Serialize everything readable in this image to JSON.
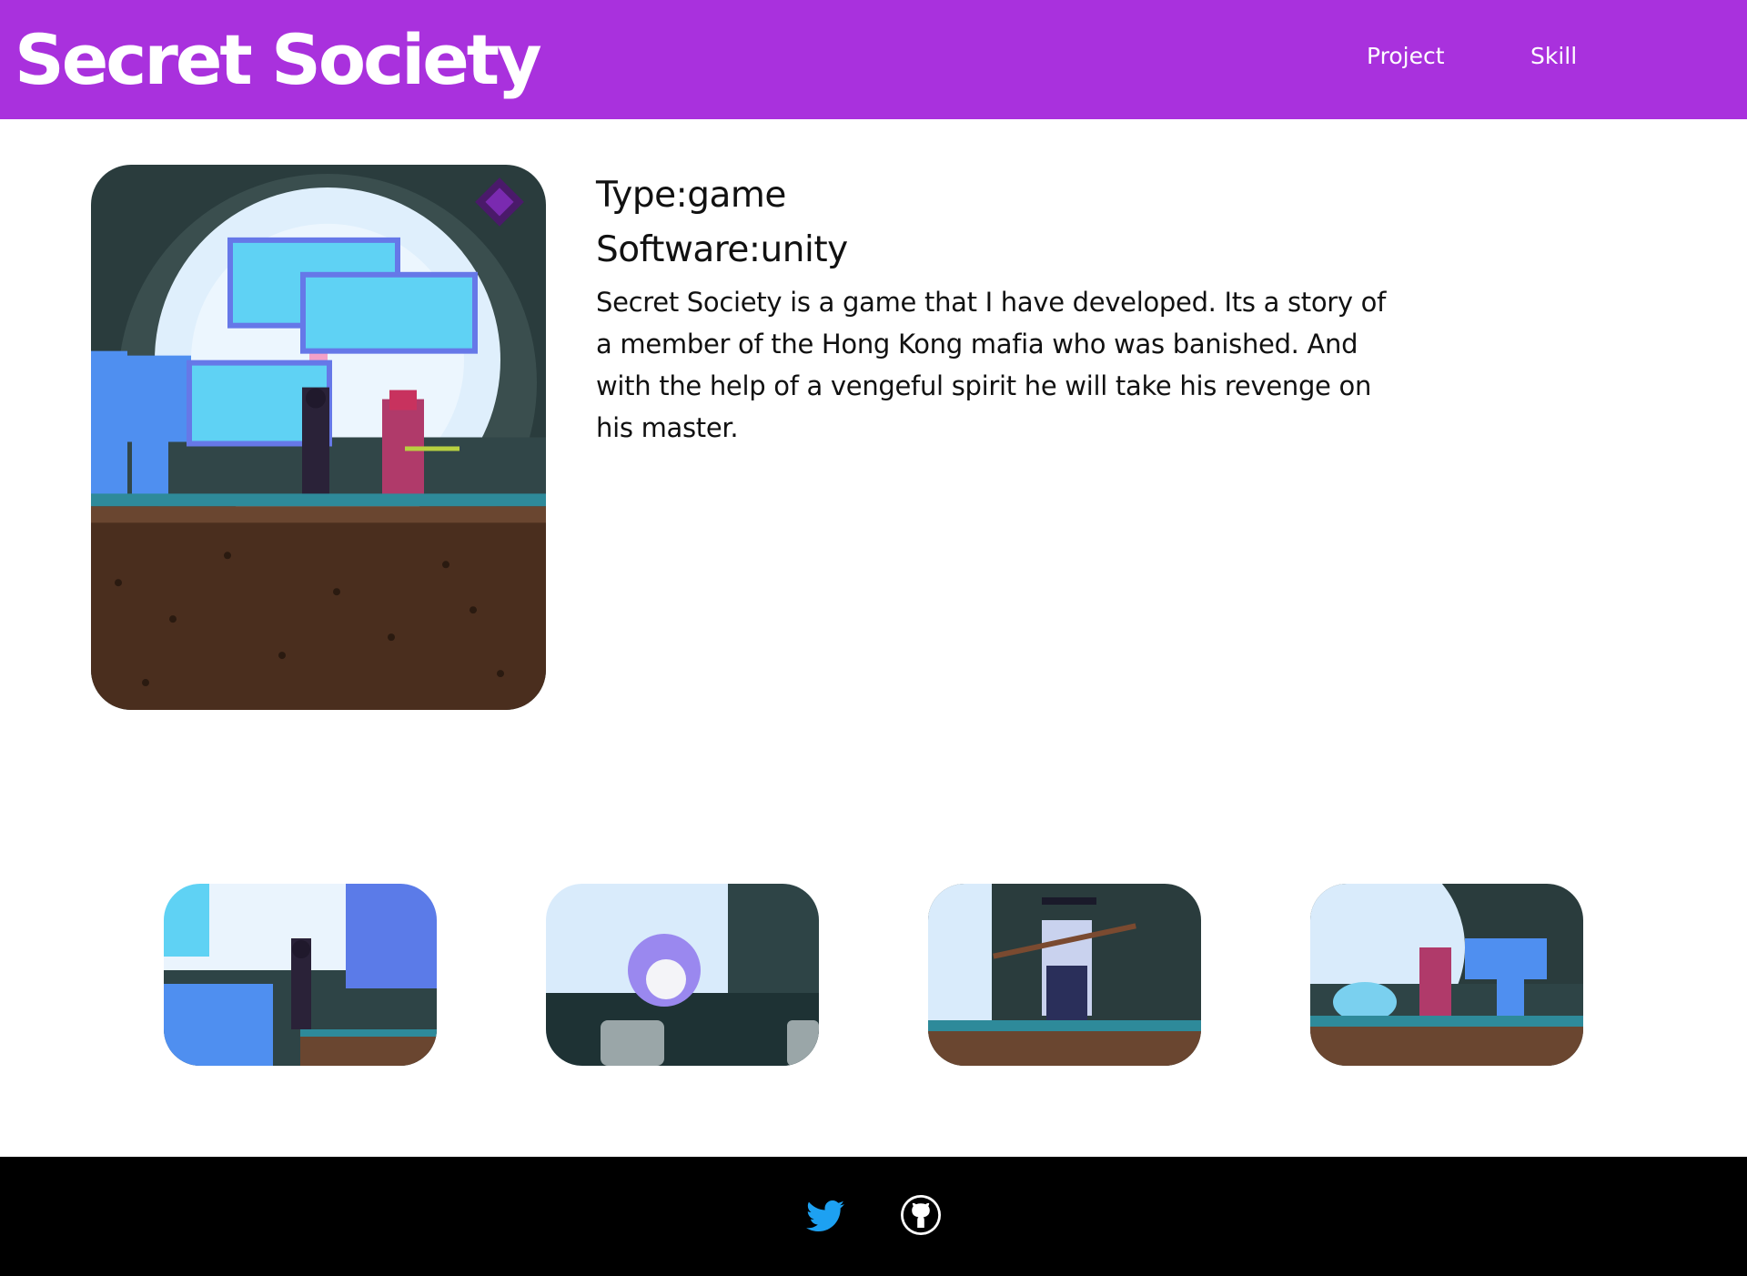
{
  "header": {
    "title": "Secret Society",
    "nav": [
      {
        "label": "Project"
      },
      {
        "label": "Skill"
      }
    ],
    "background_color": "#a931dd"
  },
  "project": {
    "type_line": "Type:game",
    "software_line": "Software:unity",
    "description": "Secret Society is a game that I have developed. Its a story of a member of the Hong Kong mafia who was banished. And with the help of a vengeful spirit he will take his revenge on his master.",
    "main_image_icon": "game-scene-moon-tree-characters"
  },
  "gallery": [
    {
      "icon": "screenshot-ninja-tree"
    },
    {
      "icon": "screenshot-spirit-graves"
    },
    {
      "icon": "screenshot-master-spear"
    },
    {
      "icon": "screenshot-demon-running"
    }
  ],
  "footer": {
    "icons": [
      "twitter-icon",
      "github-icon"
    ],
    "twitter_color": "#1da1f2",
    "background_color": "#000000"
  }
}
